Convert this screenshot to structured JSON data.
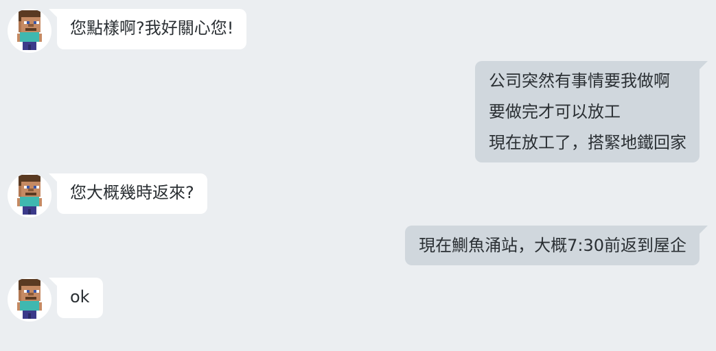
{
  "messages": [
    {
      "direction": "incoming",
      "sender": "steve-avatar",
      "lines": [
        "您點樣啊?我好關心您!"
      ]
    },
    {
      "direction": "outgoing",
      "lines": [
        "公司突然有事情要我做啊",
        "要做完才可以放工",
        "現在放工了，搭緊地鐵回家"
      ]
    },
    {
      "direction": "incoming",
      "sender": "steve-avatar",
      "lines": [
        "您大概幾時返來?"
      ]
    },
    {
      "direction": "outgoing",
      "lines": [
        "現在鰂魚涌站，大概7:30前返到屋企"
      ]
    },
    {
      "direction": "incoming",
      "sender": "steve-avatar",
      "lines": [
        "ok"
      ]
    }
  ],
  "colors": {
    "background": "#ebeef1",
    "incoming_bubble": "#ffffff",
    "outgoing_bubble": "#d0d7dd",
    "text": "#2a2f33"
  }
}
